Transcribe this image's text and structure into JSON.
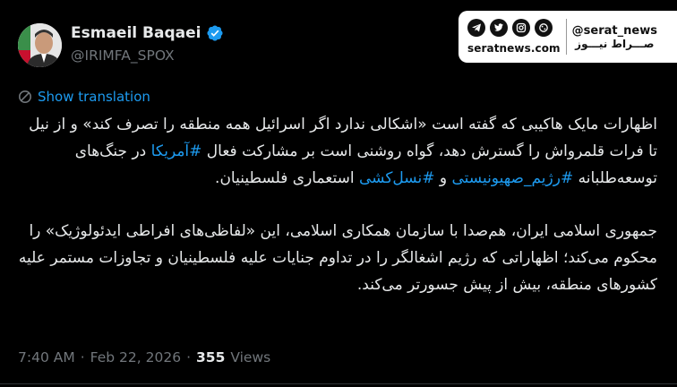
{
  "author": {
    "display_name": "Esmaeil Baqaei",
    "handle": "@IRIMFA_SPOX",
    "verified_color": "#1d9bf0"
  },
  "watermark": {
    "icons": [
      "telegram-icon",
      "twitter-icon",
      "instagram-icon",
      "aparat-icon"
    ],
    "site": "seratnews.com",
    "handle": "@serat_news",
    "brand": "صـــراط نیـــوز"
  },
  "translation_label": "Show translation",
  "body": {
    "p1": [
      {
        "t": "اظهارات مایک هاکیبی که گفته است «اشکالی ندارد اگر اسرائیل همه منطقه را تصرف کند» و از نیل تا فرات قلمرواش را گسترش دهد، گواه روشنی است بر مشارکت فعال ",
        "tag": false
      },
      {
        "t": "#آمریکا",
        "tag": true
      },
      {
        "t": " در جنگ‌های  توسعه‌طلبانه ",
        "tag": false
      },
      {
        "t": "#رژیم_صهیونیستی",
        "tag": true
      },
      {
        "t": "  و ",
        "tag": false
      },
      {
        "t": "#نسل‌کشی",
        "tag": true
      },
      {
        "t": " استعماری فلسطینیان.",
        "tag": false
      }
    ],
    "p2": "جمهوری اسلامی ایران، هم‌صدا با سازمان همکاری اسلامی، این «لفاظی‌های افراطی ایدئولوژیک» را محکوم می‌کند؛ اظهاراتی که رژیم اشغالگر را در تداوم جنایات علیه فلسطینیان و تجاوزات مستمر علیه کشورهای منطقه، بیش از پیش جسورتر می‌کند."
  },
  "meta": {
    "time": "7:40 AM",
    "sep1": "·",
    "date": "Feb 22, 2026",
    "sep2": "·",
    "views_count": "355",
    "views_label": "Views"
  }
}
